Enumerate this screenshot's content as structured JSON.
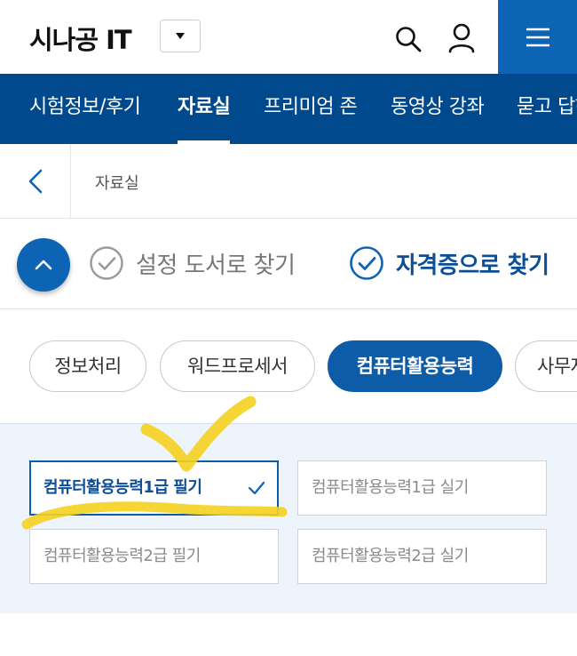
{
  "header": {
    "logo": "시나공 IT",
    "icons": {
      "search": "search-icon",
      "user": "user-icon",
      "menu": "hamburger-menu-icon",
      "dropdown": "caret-down-icon"
    }
  },
  "nav": {
    "items": [
      {
        "label": "시험정보/후기",
        "active": false
      },
      {
        "label": "자료실",
        "active": true
      },
      {
        "label": "프리미엄 존",
        "active": false
      },
      {
        "label": "동영상 강좌",
        "active": false
      },
      {
        "label": "묻고 답하기",
        "active": false
      }
    ]
  },
  "breadcrumb": {
    "current": "자료실"
  },
  "search_mode": {
    "options": [
      {
        "label": "설정 도서로 찾기",
        "selected": false
      },
      {
        "label": "자격증으로 찾기",
        "selected": true
      }
    ]
  },
  "categories": [
    {
      "label": "정보처리",
      "active": false
    },
    {
      "label": "워드프로세서",
      "active": false
    },
    {
      "label": "컴퓨터활용능력",
      "active": true
    },
    {
      "label": "사무자동화",
      "active": false
    }
  ],
  "subcategories": [
    {
      "label": "컴퓨터활용능력1급 필기",
      "active": true
    },
    {
      "label": "컴퓨터활용능력1급 실기",
      "active": false
    },
    {
      "label": "컴퓨터활용능력2급 필기",
      "active": false
    },
    {
      "label": "컴퓨터활용능력2급 실기",
      "active": false
    }
  ],
  "colors": {
    "primary": "#0d63b4",
    "nav_bg": "#00498d",
    "panel_bg": "#eef4fb",
    "highlighter": "#f5d21f"
  }
}
